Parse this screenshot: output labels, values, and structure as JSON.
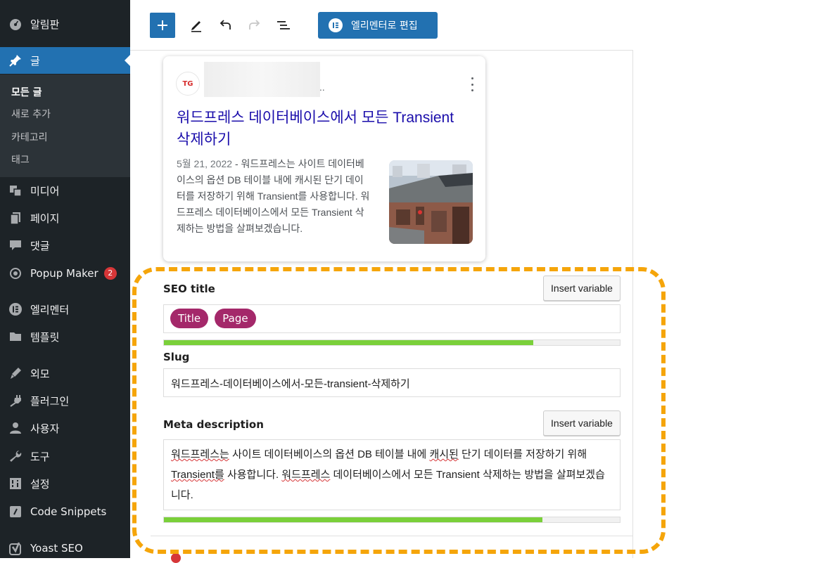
{
  "sidebar": {
    "items": [
      {
        "label": "알림판",
        "icon": "dashboard-icon"
      },
      {
        "label": "글",
        "icon": "pushpin-icon"
      },
      {
        "label": "미디어",
        "icon": "media-icon"
      },
      {
        "label": "페이지",
        "icon": "pages-icon"
      },
      {
        "label": "댓글",
        "icon": "comments-icon"
      },
      {
        "label": "Popup Maker",
        "icon": "popup-maker-icon",
        "badge": "2"
      },
      {
        "label": "엘리멘터",
        "icon": "elementor-icon"
      },
      {
        "label": "템플릿",
        "icon": "folder-icon"
      },
      {
        "label": "외모",
        "icon": "appearance-icon"
      },
      {
        "label": "플러그인",
        "icon": "plugins-icon"
      },
      {
        "label": "사용자",
        "icon": "users-icon"
      },
      {
        "label": "도구",
        "icon": "tools-icon"
      },
      {
        "label": "설정",
        "icon": "settings-icon"
      },
      {
        "label": "Code Snippets",
        "icon": "code-icon"
      },
      {
        "label": "Yoast SEO",
        "icon": "yoast-icon"
      }
    ],
    "submenu": [
      "모든 글",
      "새로 추가",
      "카테고리",
      "태그"
    ]
  },
  "toolbar": {
    "elementor_label": "엘리멘터로 편집"
  },
  "preview": {
    "site_logo_text": "TG",
    "site_suffix": "..",
    "title": "워드프레스 데이터베이스에서 모든 Transient 삭제하기",
    "date": "5월 21, 2022",
    "separator": " - ",
    "description": "워드프레스는 사이트 데이터베이스의 옵션 DB 테이블 내에 캐시된 단기 데이터를 저장하기 위해 Transient를 사용합니다. 워드프레스 데이터베이스에서 모든 Transient 삭제하는 방법을 살펴보겠습니다."
  },
  "seo": {
    "seo_title_label": "SEO title",
    "insert_variable": "Insert variable",
    "title_pills": [
      "Title",
      "Page"
    ],
    "title_progress": 0.81,
    "slug_label": "Slug",
    "slug_value": "워드프레스-데이터베이스에서-모든-transient-삭제하기",
    "meta_label": "Meta description",
    "meta_segments": [
      {
        "text": "워드프레스는",
        "squiggle": true
      },
      {
        "text": " 사이트 데이터베이스의 옵션 DB 테이블 내에 ",
        "squiggle": false
      },
      {
        "text": "캐시된",
        "squiggle": true
      },
      {
        "text": " 단기 데이터를 저장하기 위해 ",
        "squiggle": false
      },
      {
        "text": "Transient를",
        "squiggle": true
      },
      {
        "text": " 사용합니다. ",
        "squiggle": false
      },
      {
        "text": "워드프레스",
        "squiggle": true
      },
      {
        "text": " 데이터베이스에서 모든 Transient 삭제하는 방법을 살펴보겠습니다.",
        "squiggle": false
      }
    ],
    "meta_progress": 0.83
  },
  "colors": {
    "sidebar_bg": "#1d2327",
    "accent": "#2271b1",
    "pill": "#a4286a",
    "progress_good": "#7ad03a",
    "highlight": "#f5a50a",
    "link": "#1a0dab"
  }
}
